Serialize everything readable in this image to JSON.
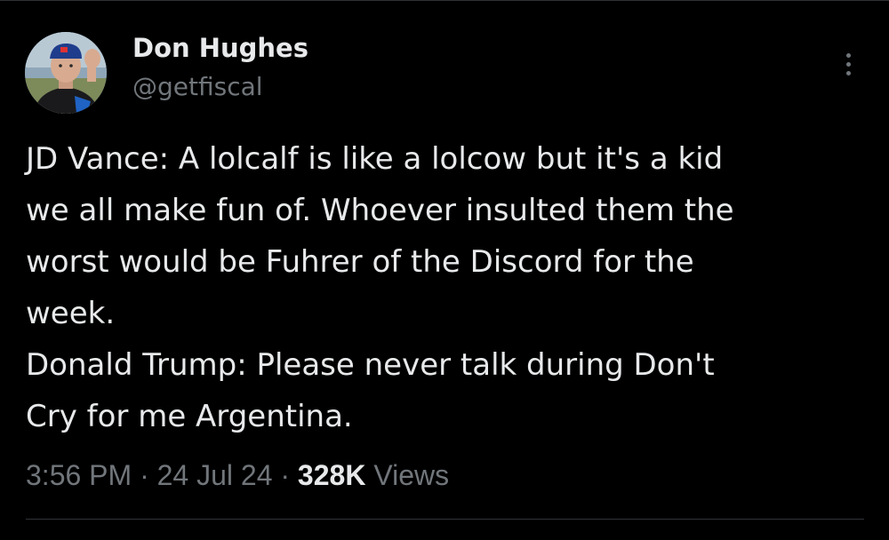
{
  "author": {
    "display_name": "Don Hughes",
    "handle": "@getfiscal",
    "avatar_icon": "profile-photo"
  },
  "tweet": {
    "lines": [
      "JD Vance: A lolcalf is like a lolcow but it's a kid",
      "we all make fun of. Whoever insulted them the",
      "worst would be Fuhrer of the Discord for the",
      "week.",
      "Donald Trump: Please never talk during Don't",
      "Cry for me Argentina."
    ]
  },
  "meta": {
    "time": "3:56 PM",
    "separator": " · ",
    "date": "24 Jul 24",
    "views_count": "328K",
    "views_label": "Views"
  },
  "more_menu_icon": "more-vertical-icon",
  "colors": {
    "background": "#000000",
    "primary_text": "#e7e9ea",
    "secondary_text": "#71767b",
    "divider": "#2f3336"
  }
}
